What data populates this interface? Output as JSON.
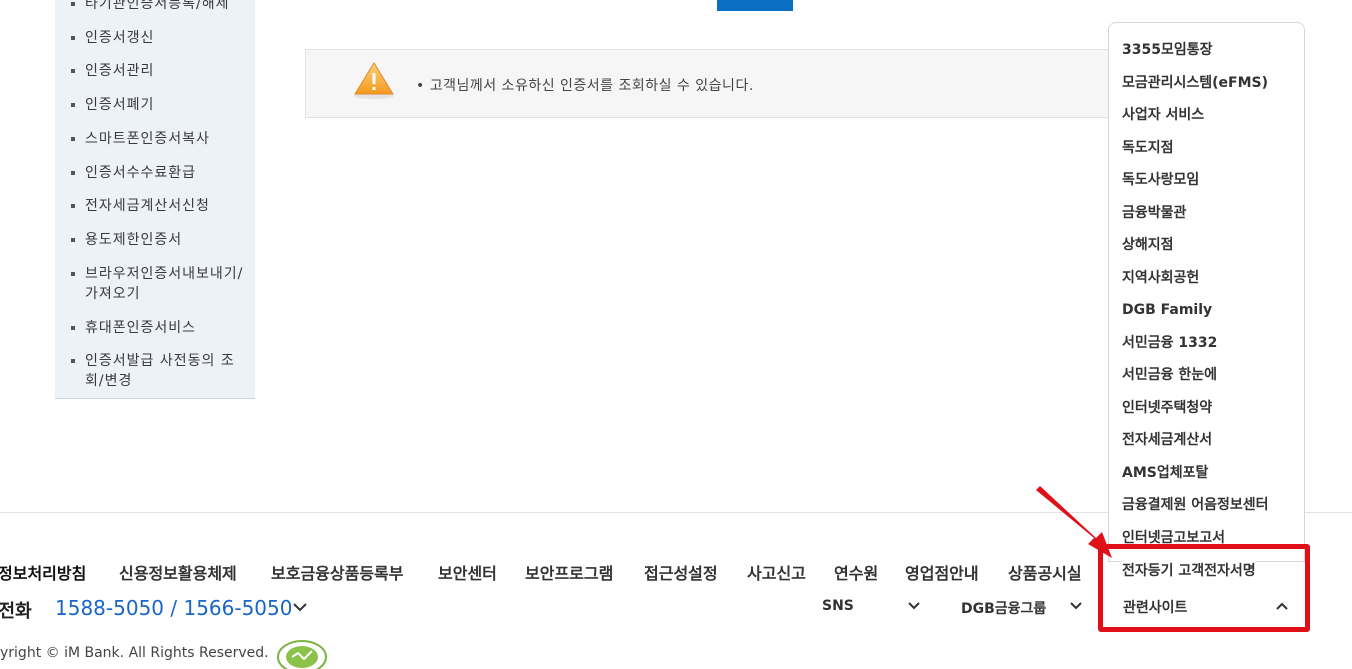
{
  "sidebar": {
    "items": [
      {
        "label": "타기관인증서등록/해제"
      },
      {
        "label": "인증서갱신"
      },
      {
        "label": "인증서관리"
      },
      {
        "label": "인증서폐기"
      },
      {
        "label": "스마트폰인증서복사"
      },
      {
        "label": "인증서수수료환급"
      },
      {
        "label": "전자세금계산서신청"
      },
      {
        "label": "용도제한인증서"
      },
      {
        "label": "브라우저인증서내보내기/가져오기"
      },
      {
        "label": "휴대폰인증서비스"
      },
      {
        "label": "인증서발급 사전동의 조회/변경"
      }
    ]
  },
  "notice": {
    "text": "• 고객님께서 소유하신 인증서를 조회하실 수 있습니다.",
    "icon": "warning-icon"
  },
  "footer": {
    "links": [
      "정보처리방침",
      "신용정보활용체제",
      "보호금융상품등록부",
      "보안센터",
      "보안프로그램",
      "접근성설정",
      "사고신고",
      "연수원",
      "영업점안내",
      "상품공시실"
    ],
    "cs_label": "고전화",
    "cs_number": "1588-5050 / 1566-5050",
    "sns_label": "SNS",
    "group_label": "DGB금융그룹",
    "related_label": "관련사이트",
    "copyright": "yright © iM Bank. All Rights Reserved."
  },
  "related_sites": [
    "3355모임통장",
    "모금관리시스템(eFMS)",
    "사업자 서비스",
    "독도지점",
    "독도사랑모임",
    "금융박물관",
    "상해지점",
    "지역사회공헌",
    "DGB Family",
    "서민금융 1332",
    "서민금융 한눈에",
    "인터넷주택청약",
    "전자세금계산서",
    "AMS업체포탈",
    "금융결제원 어음정보센터",
    "인터넷금고보고서",
    "전자등기 고객전자서명"
  ],
  "colors": {
    "accent": "#0a6fc2",
    "phone": "#1a66c4",
    "highlight": "#e01019"
  }
}
